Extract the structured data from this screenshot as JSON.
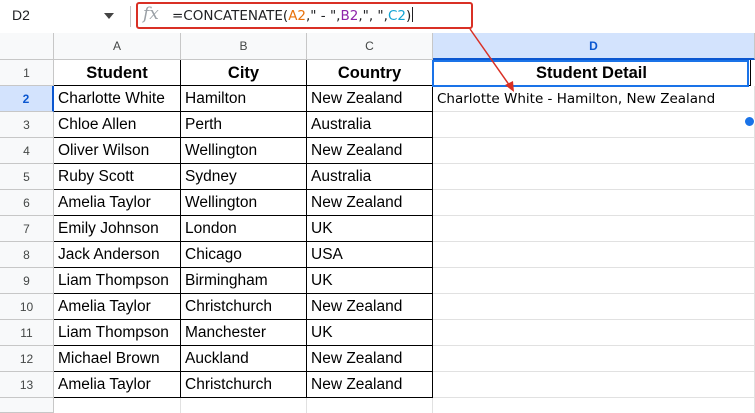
{
  "name_box": {
    "ref": "D2"
  },
  "formula_bar": {
    "fx_label": "fx",
    "formula_parts": [
      "=CONCATENATE(",
      "A2",
      ",\" - \",",
      "B2",
      ",\", \",",
      "C2",
      ")"
    ]
  },
  "columns": [
    "A",
    "B",
    "C",
    "D"
  ],
  "row_numbers": [
    "1",
    "2",
    "3",
    "4",
    "5",
    "6",
    "7",
    "8",
    "9",
    "10",
    "11",
    "12",
    "13"
  ],
  "headers": {
    "a": "Student",
    "b": "City",
    "c": "Country",
    "d": "Student Detail"
  },
  "rows": [
    {
      "student": "Charlotte White",
      "city": "Hamilton",
      "country": "New Zealand",
      "detail": "Charlotte White - Hamilton, New Zealand"
    },
    {
      "student": "Chloe Allen",
      "city": "Perth",
      "country": "Australia",
      "detail": ""
    },
    {
      "student": "Oliver Wilson",
      "city": "Wellington",
      "country": "New Zealand",
      "detail": ""
    },
    {
      "student": "Ruby Scott",
      "city": "Sydney",
      "country": "Australia",
      "detail": ""
    },
    {
      "student": "Amelia Taylor",
      "city": "Wellington",
      "country": "New Zealand",
      "detail": ""
    },
    {
      "student": "Emily Johnson",
      "city": "London",
      "country": "UK",
      "detail": ""
    },
    {
      "student": "Jack Anderson",
      "city": "Chicago",
      "country": "USA",
      "detail": ""
    },
    {
      "student": "Liam Thompson",
      "city": "Birmingham",
      "country": "UK",
      "detail": ""
    },
    {
      "student": "Amelia Taylor",
      "city": "Christchurch",
      "country": "New Zealand",
      "detail": ""
    },
    {
      "student": "Liam Thompson",
      "city": "Manchester",
      "country": "UK",
      "detail": ""
    },
    {
      "student": "Michael Brown",
      "city": "Auckland",
      "country": "New Zealand",
      "detail": ""
    },
    {
      "student": "Amelia Taylor",
      "city": "Christchurch",
      "country": "New Zealand",
      "detail": ""
    }
  ],
  "colors": {
    "formula_highlight": "#d93025",
    "arrow": "#d93025",
    "selection": "#1a73e8"
  },
  "icons": {
    "fx": "function-icon",
    "name_box_dropdown": "chevron-down-icon"
  }
}
